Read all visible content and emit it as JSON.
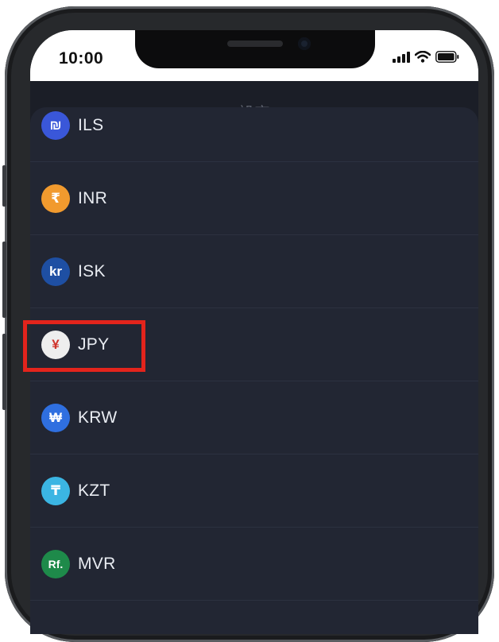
{
  "status_bar": {
    "time": "10:00",
    "icons": [
      "signal-bars-icon",
      "wifi-icon",
      "battery-icon"
    ]
  },
  "header": {
    "title": "設定",
    "back_icon": "chevron-left-icon"
  },
  "currencies": [
    {
      "code": "ILS",
      "symbol": "₪",
      "color": "#3a57d9",
      "symbol_color": "#ffffff"
    },
    {
      "code": "INR",
      "symbol": "₹",
      "color": "#f19a2e",
      "symbol_color": "#ffffff"
    },
    {
      "code": "ISK",
      "symbol": "kr",
      "color": "#1e4fa3",
      "symbol_color": "#ffffff"
    },
    {
      "code": "JPY",
      "symbol": "¥",
      "color": "#eeeeee",
      "symbol_color": "#d0342c"
    },
    {
      "code": "KRW",
      "symbol": "₩",
      "color": "#2f6fe0",
      "symbol_color": "#ffffff"
    },
    {
      "code": "KZT",
      "symbol": "₸",
      "color": "#3bb5e3",
      "symbol_color": "#ffffff"
    },
    {
      "code": "MVR",
      "symbol": "Rf.",
      "color": "#1e8a4a",
      "symbol_color": "#ffffff"
    }
  ],
  "highlight": {
    "target": "JPY",
    "color": "#e3241c"
  }
}
